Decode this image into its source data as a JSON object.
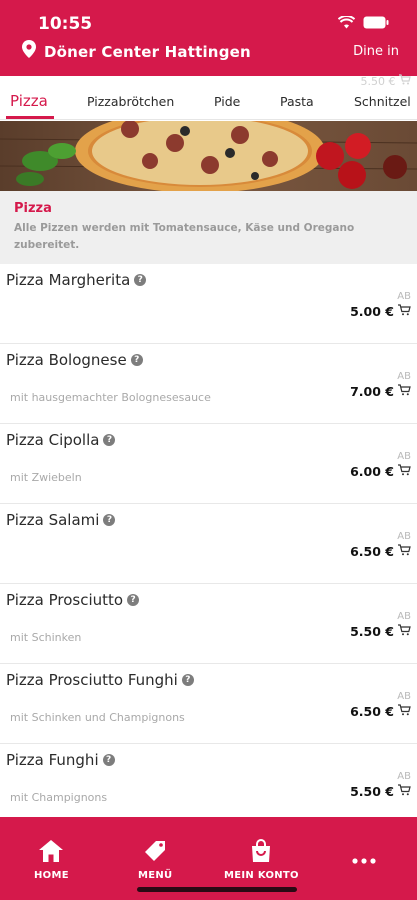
{
  "status_bar": {
    "time": "10:55"
  },
  "header": {
    "location": "Döner Center Hattingen",
    "mode": "Dine in"
  },
  "ghost_price": "5.50 €",
  "tabs": [
    {
      "label": "Pizza",
      "active": true
    },
    {
      "label": "Pizzabrötchen"
    },
    {
      "label": "Pide"
    },
    {
      "label": "Pasta"
    },
    {
      "label": "Schnitzel"
    }
  ],
  "category": {
    "title": "Pizza",
    "description_line1": "Alle Pizzen werden mit Tomatensauce, Käse und Oregano",
    "description_line2": "zubereitet."
  },
  "items": [
    {
      "name": "Pizza Margherita",
      "desc": "",
      "ab": "AB",
      "price": "5.00 €"
    },
    {
      "name": "Pizza Bolognese",
      "desc": "mit hausgemachter Bolognesesauce",
      "ab": "AB",
      "price": "7.00 €"
    },
    {
      "name": "Pizza Cipolla",
      "desc": "mit Zwiebeln",
      "ab": "AB",
      "price": "6.00 €"
    },
    {
      "name": "Pizza Salami",
      "desc": "",
      "ab": "AB",
      "price": "6.50 €"
    },
    {
      "name": "Pizza Prosciutto",
      "desc": "mit Schinken",
      "ab": "AB",
      "price": "5.50 €"
    },
    {
      "name": "Pizza Prosciutto Funghi",
      "desc": "mit Schinken und Champignons",
      "ab": "AB",
      "price": "6.50 €"
    },
    {
      "name": "Pizza Funghi",
      "desc": "mit Champignons",
      "ab": "AB",
      "price": "5.50 €"
    }
  ],
  "bottom_nav": {
    "home": "HOME",
    "menu": "MENÜ",
    "account": "MEIN KONTO"
  },
  "colors": {
    "brand": "#d5194b"
  },
  "icons": {
    "location": "location-pin-icon",
    "cart": "cart-icon",
    "info": "info-icon",
    "home": "home-icon",
    "menu": "tag-icon",
    "account": "shopping-bag-icon",
    "more": "more-dots-icon"
  }
}
